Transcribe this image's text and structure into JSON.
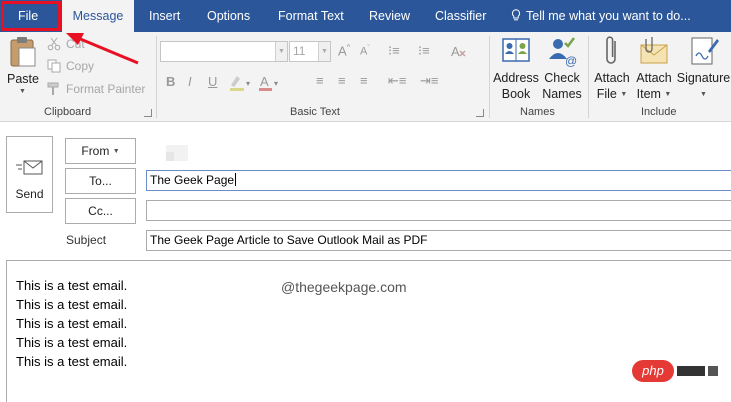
{
  "tabs": [
    {
      "label": "File"
    },
    {
      "label": "Message"
    },
    {
      "label": "Insert"
    },
    {
      "label": "Options"
    },
    {
      "label": "Format Text"
    },
    {
      "label": "Review"
    },
    {
      "label": "Classifier"
    }
  ],
  "tell_me": "Tell me what you want to do...",
  "ribbon": {
    "clipboard": {
      "paste": "Paste",
      "cut": "Cut",
      "copy": "Copy",
      "format_painter": "Format Painter",
      "label": "Clipboard"
    },
    "basic_text": {
      "font_size": "11",
      "label": "Basic Text"
    },
    "names": {
      "address_book_line1": "Address",
      "address_book_line2": "Book",
      "check_names_line1": "Check",
      "check_names_line2": "Names",
      "label": "Names"
    },
    "include": {
      "attach_file_line1": "Attach",
      "attach_file_line2": "File",
      "attach_item_line1": "Attach",
      "attach_item_line2": "Item",
      "signature": "Signature",
      "label": "Include"
    }
  },
  "compose": {
    "send": "Send",
    "from": "From",
    "to": "To...",
    "cc": "Cc...",
    "subject_label": "Subject",
    "to_value": "The Geek Page",
    "cc_value": "",
    "subject_value": "The Geek Page Article to Save Outlook Mail as PDF"
  },
  "body_lines": [
    "This is a test email.",
    "This is a test email.",
    "This is a test email.",
    "This is a test email.",
    "This is a test email."
  ],
  "watermark": "@thegeekpage.com",
  "php_badge": "php",
  "colors": {
    "accent": "#2b579a",
    "annotation": "#e81123"
  }
}
